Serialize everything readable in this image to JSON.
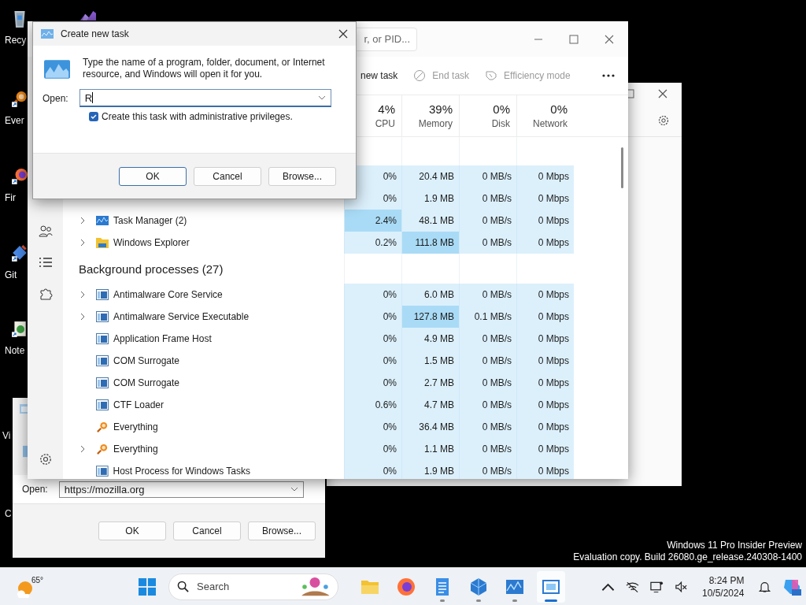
{
  "desktop": {
    "icons": [
      {
        "kind": "bin",
        "label": "Recy"
      },
      {
        "kind": "studio"
      },
      {
        "kind": "everything",
        "label": "Ever"
      },
      {
        "kind": "firefox",
        "label": "Fir"
      },
      {
        "kind": "git",
        "label": "Git"
      },
      {
        "kind": "notepad",
        "label": "Note"
      },
      {
        "kind": "blank",
        "label": "Vi"
      },
      {
        "kind": "blank",
        "label": "C"
      }
    ]
  },
  "back_dialog": {
    "open_label": "Open:",
    "value": "https://mozilla.org",
    "buttons": [
      "OK",
      "Cancel",
      "Browse..."
    ]
  },
  "task_manager": {
    "search": {
      "placeholder": "r, or PID..."
    },
    "toolbar": [
      {
        "kind": "run",
        "label": "new task",
        "disabled": false
      },
      {
        "kind": "end",
        "label": "End task",
        "disabled": true
      },
      {
        "kind": "efficiency",
        "label": "Efficiency mode",
        "disabled": true
      }
    ],
    "columns": [
      {
        "value": "4%",
        "label": "CPU"
      },
      {
        "value": "39%",
        "label": "Memory"
      },
      {
        "value": "0%",
        "label": "Disk"
      },
      {
        "value": "0%",
        "label": "Network"
      }
    ],
    "rows": [
      {
        "kind": "group"
      },
      {
        "kind": "covered",
        "cells": [
          {
            "text": "0%",
            "hot": false
          },
          {
            "text": "20.4 MB",
            "hot": false
          },
          {
            "text": "0 MB/s",
            "hot": false
          },
          {
            "text": "0 Mbps",
            "hot": false
          }
        ]
      },
      {
        "kind": "covered",
        "cells": [
          {
            "text": "0%",
            "hot": false
          },
          {
            "text": "1.9 MB",
            "hot": false
          },
          {
            "text": "0 MB/s",
            "hot": false
          },
          {
            "text": "0 Mbps",
            "hot": false
          }
        ]
      },
      {
        "kind": "taskmgr",
        "name": "Task Manager (2)",
        "expandable": true,
        "cells": [
          {
            "text": "2.4%",
            "hot": true
          },
          {
            "text": "48.1 MB",
            "hot": false
          },
          {
            "text": "0 MB/s",
            "hot": false
          },
          {
            "text": "0 Mbps",
            "hot": false
          }
        ]
      },
      {
        "kind": "explorer",
        "name": "Windows Explorer",
        "expandable": true,
        "cells": [
          {
            "text": "0.2%",
            "hot": false
          },
          {
            "text": "111.8 MB",
            "hot": true
          },
          {
            "text": "0 MB/s",
            "hot": false
          },
          {
            "text": "0 Mbps",
            "hot": false
          }
        ]
      },
      {
        "kind": "group",
        "label": "Background processes (27)"
      },
      {
        "kind": "app",
        "name": "Antimalware Core Service",
        "expandable": true,
        "cells": [
          {
            "text": "0%",
            "hot": false
          },
          {
            "text": "6.0 MB",
            "hot": false
          },
          {
            "text": "0 MB/s",
            "hot": false
          },
          {
            "text": "0 Mbps",
            "hot": false
          }
        ]
      },
      {
        "kind": "app",
        "name": "Antimalware Service Executable",
        "expandable": true,
        "cells": [
          {
            "text": "0%",
            "hot": false
          },
          {
            "text": "127.8 MB",
            "hot": true
          },
          {
            "text": "0.1 MB/s",
            "hot": false
          },
          {
            "text": "0 Mbps",
            "hot": false
          }
        ]
      },
      {
        "kind": "app",
        "name": "Application Frame Host",
        "expandable": false,
        "cells": [
          {
            "text": "0%",
            "hot": false
          },
          {
            "text": "4.9 MB",
            "hot": false
          },
          {
            "text": "0 MB/s",
            "hot": false
          },
          {
            "text": "0 Mbps",
            "hot": false
          }
        ]
      },
      {
        "kind": "app",
        "name": "COM Surrogate",
        "expandable": false,
        "cells": [
          {
            "text": "0%",
            "hot": false
          },
          {
            "text": "1.5 MB",
            "hot": false
          },
          {
            "text": "0 MB/s",
            "hot": false
          },
          {
            "text": "0 Mbps",
            "hot": false
          }
        ]
      },
      {
        "kind": "app",
        "name": "COM Surrogate",
        "expandable": false,
        "cells": [
          {
            "text": "0%",
            "hot": false
          },
          {
            "text": "2.7 MB",
            "hot": false
          },
          {
            "text": "0 MB/s",
            "hot": false
          },
          {
            "text": "0 Mbps",
            "hot": false
          }
        ]
      },
      {
        "kind": "app",
        "name": "CTF Loader",
        "expandable": false,
        "cells": [
          {
            "text": "0.6%",
            "hot": false
          },
          {
            "text": "4.7 MB",
            "hot": false
          },
          {
            "text": "0 MB/s",
            "hot": false
          },
          {
            "text": "0 Mbps",
            "hot": false
          }
        ]
      },
      {
        "kind": "everything",
        "name": "Everything",
        "expandable": false,
        "cells": [
          {
            "text": "0%",
            "hot": false
          },
          {
            "text": "36.4 MB",
            "hot": false
          },
          {
            "text": "0 MB/s",
            "hot": false
          },
          {
            "text": "0 Mbps",
            "hot": false
          }
        ]
      },
      {
        "kind": "everything",
        "name": "Everything",
        "expandable": true,
        "cells": [
          {
            "text": "0%",
            "hot": false
          },
          {
            "text": "1.1 MB",
            "hot": false
          },
          {
            "text": "0 MB/s",
            "hot": false
          },
          {
            "text": "0 Mbps",
            "hot": false
          }
        ]
      },
      {
        "kind": "app",
        "name": "Host Process for Windows Tasks",
        "expandable": false,
        "cells": [
          {
            "text": "0%",
            "hot": false
          },
          {
            "text": "1.9 MB",
            "hot": false
          },
          {
            "text": "0 MB/s",
            "hot": false
          },
          {
            "text": "0 Mbps",
            "hot": false
          }
        ]
      }
    ]
  },
  "dialog": {
    "title": "Create new task",
    "message": "Type the name of a program, folder, document, or Internet resource, and Windows will open it for you.",
    "open_label": "Open:",
    "value": "R",
    "checkbox": {
      "label": "Create this task with administrative privileges.",
      "checked": true
    },
    "buttons": [
      {
        "label": "OK",
        "default": true
      },
      {
        "label": "Cancel",
        "default": false
      },
      {
        "label": "Browse...",
        "default": false
      }
    ]
  },
  "evaluation_notice": [
    "Windows 11 Pro Insider Preview",
    "Evaluation copy. Build 26080.ge_release.240308-1400"
  ],
  "taskbar": {
    "weather": {
      "temp": "65°"
    },
    "search": {
      "label": "Search"
    },
    "apps": [
      {
        "kind": "folder",
        "running": false,
        "active": false
      },
      {
        "kind": "firefox",
        "running": false,
        "active": false
      },
      {
        "kind": "notepad",
        "running": true,
        "active": false
      },
      {
        "kind": "cube",
        "running": true,
        "active": false
      },
      {
        "kind": "taskmgr",
        "running": true,
        "active": false
      },
      {
        "kind": "frame",
        "running": true,
        "active": true
      }
    ],
    "clock": {
      "time": "8:24 PM",
      "date": "10/5/2024"
    }
  }
}
